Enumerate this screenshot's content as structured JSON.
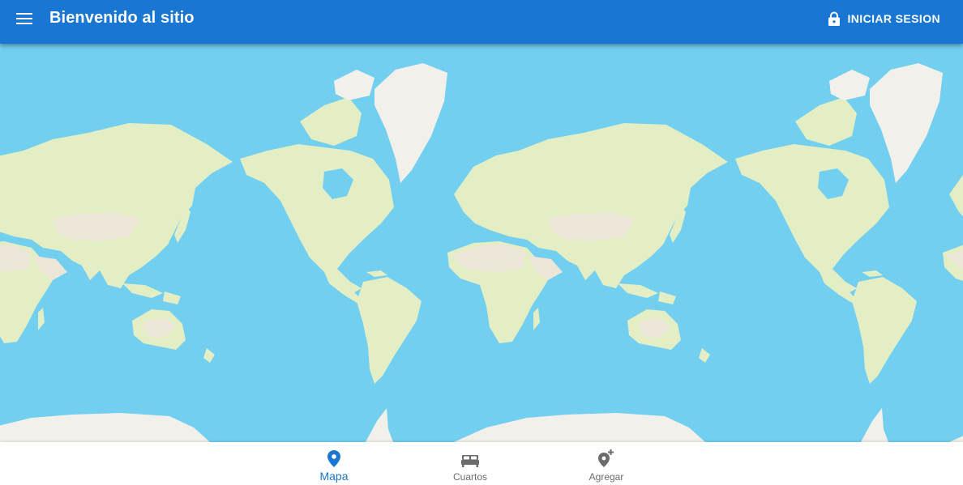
{
  "app_bar": {
    "title": "Bienvenido al sitio",
    "menu_icon": "menu-icon",
    "login": {
      "icon": "lock-icon",
      "label": "INICIAR SESION"
    }
  },
  "map": {
    "style": "world-map-tiles",
    "colors": {
      "ocean": "#72cff0",
      "land": "#e3eec4",
      "ice": "#f2f0ea",
      "desert": "#ece6d8"
    }
  },
  "bottom_nav": {
    "items": [
      {
        "label": "Mapa",
        "icon": "location-pin-icon",
        "active": true
      },
      {
        "label": "Cuartos",
        "icon": "bed-icon",
        "active": false
      },
      {
        "label": "Agregar",
        "icon": "add-location-icon",
        "active": false
      }
    ]
  },
  "colors": {
    "primary": "#1976d2",
    "inactive": "#6b6b6b",
    "surface": "#ffffff"
  }
}
